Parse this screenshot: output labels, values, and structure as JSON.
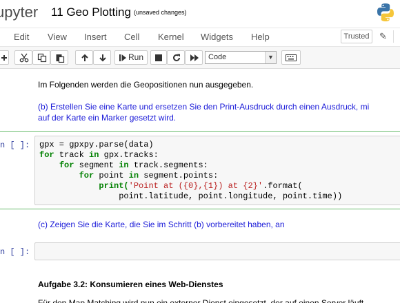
{
  "header": {
    "logo_text": "upyter",
    "notebook_name": "11 Geo Plotting",
    "save_status": "(unsaved changes)"
  },
  "menubar": {
    "items": [
      "Edit",
      "View",
      "Insert",
      "Cell",
      "Kernel",
      "Widgets",
      "Help"
    ],
    "trusted_label": "Trusted"
  },
  "toolbar": {
    "run_label": "Run",
    "cell_type": "Code"
  },
  "cells": {
    "md1": "Im Folgenden werden die Geopositionen nun ausgegeben.",
    "md2_line1": "(b) Erstellen Sie eine Karte und ersetzen Sie den Print-Ausdruck durch einen Ausdruck, mi",
    "md2_line2": "auf der Karte ein Marker gesetzt wird.",
    "code1_prompt": "n [ ]:",
    "md3": "(c) Zeigen Sie die Karte, die Sie im Schritt (b) vorbereitet haben, an",
    "code2_prompt": "n [ ]:",
    "heading": "Aufgabe 3.2: Konsumieren eines Web-Dienstes",
    "bottom_text": "Für den Map Matching wird nun ein externer Dienst eingesetzt, der auf einen Server läuft"
  },
  "code1": {
    "l1a": "gpx = gpxpy.parse(data)",
    "l2_kw1": "for",
    "l2_mid": " track ",
    "l2_kw2": "in",
    "l2_end": " gpx.tracks:",
    "l3_kw1": "for",
    "l3_mid": " segment ",
    "l3_kw2": "in",
    "l3_end": " track.segments:",
    "l4_kw1": "for",
    "l4_mid": " point ",
    "l4_kw2": "in",
    "l4_end": " segment.points:",
    "l5_fn": "print(",
    "l5_str": "'Point at ({0},{1}) at {2}'",
    "l5_end": ".format(",
    "l6": "point.latitude, point.longitude, point.time))"
  }
}
